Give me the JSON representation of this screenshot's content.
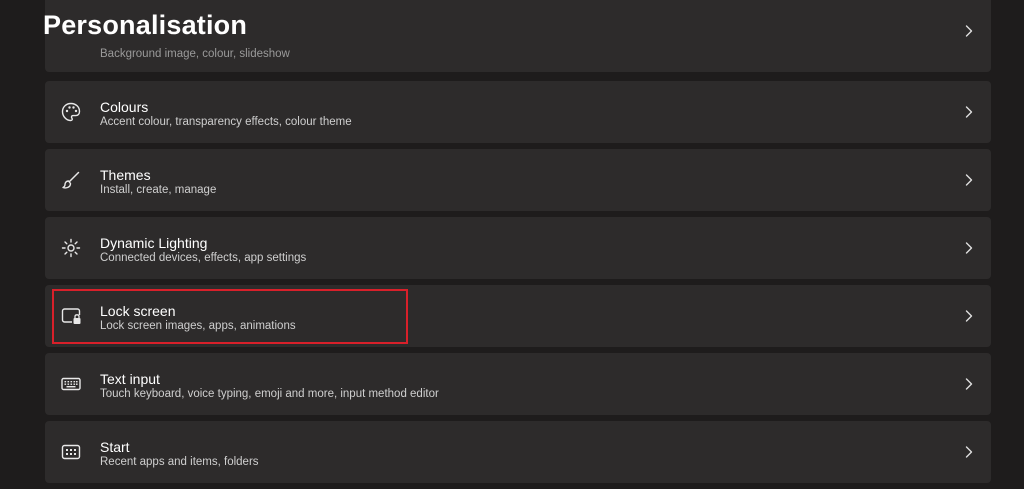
{
  "header": {
    "title": "Personalisation"
  },
  "items": [
    {
      "label": "",
      "description": "Background image, colour, slideshow",
      "icon": "background-icon"
    },
    {
      "label": "Colours",
      "description": "Accent colour, transparency effects, colour theme",
      "icon": "palette-icon"
    },
    {
      "label": "Themes",
      "description": "Install, create, manage",
      "icon": "brush-icon"
    },
    {
      "label": "Dynamic Lighting",
      "description": "Connected devices, effects, app settings",
      "icon": "lighting-icon"
    },
    {
      "label": "Lock screen",
      "description": "Lock screen images, apps, animations",
      "icon": "lock-screen-icon"
    },
    {
      "label": "Text input",
      "description": "Touch keyboard, voice typing, emoji and more, input method editor",
      "icon": "keyboard-icon"
    },
    {
      "label": "Start",
      "description": "Recent apps and items, folders",
      "icon": "start-icon"
    }
  ],
  "colors": {
    "background": "#1e1c1c",
    "card": "#2d2b2b",
    "highlight": "#d8202a"
  }
}
